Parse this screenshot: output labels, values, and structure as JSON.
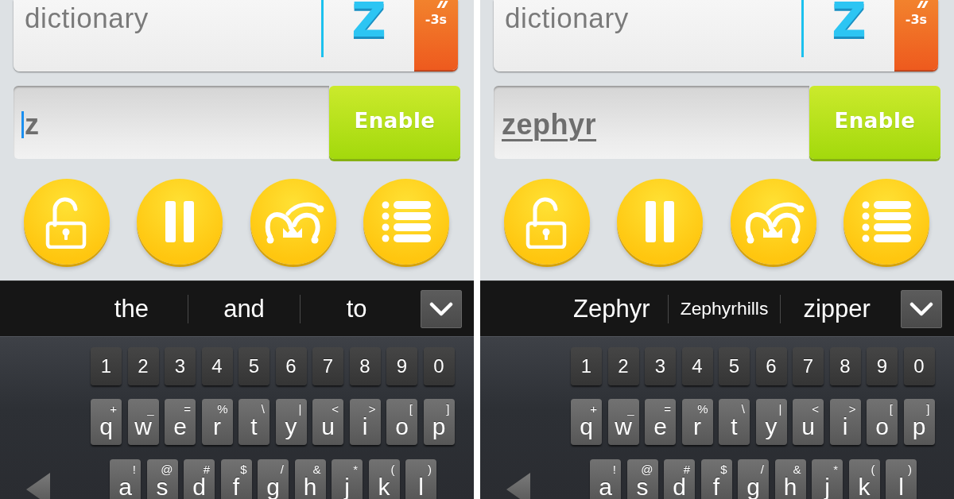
{
  "screens": [
    {
      "clue": {
        "text": "dictionary",
        "letter": "Z",
        "penalty": "-3s"
      },
      "answer_field": {
        "value": "z",
        "cursor": true,
        "underlined": false
      },
      "submit_button": {
        "label": "Enable"
      },
      "suggestions": [
        "the",
        "and",
        "to"
      ],
      "keyboard": {
        "number_row": [
          "1",
          "2",
          "3",
          "4",
          "5",
          "6",
          "7",
          "8",
          "9",
          "0"
        ],
        "letter_rows": [
          [
            {
              "key": "q",
              "alt": "+"
            },
            {
              "key": "w",
              "alt": "_"
            },
            {
              "key": "e",
              "alt": "="
            },
            {
              "key": "r",
              "alt": "%"
            },
            {
              "key": "t",
              "alt": "\\"
            },
            {
              "key": "y",
              "alt": "|"
            },
            {
              "key": "u",
              "alt": "<"
            },
            {
              "key": "i",
              "alt": ">"
            },
            {
              "key": "o",
              "alt": "["
            },
            {
              "key": "p",
              "alt": "]"
            }
          ],
          [
            {
              "key": "a",
              "alt": "!"
            },
            {
              "key": "s",
              "alt": "@"
            },
            {
              "key": "d",
              "alt": "#"
            },
            {
              "key": "f",
              "alt": "$"
            },
            {
              "key": "g",
              "alt": "/"
            },
            {
              "key": "h",
              "alt": "&"
            },
            {
              "key": "j",
              "alt": "*"
            },
            {
              "key": "k",
              "alt": "("
            },
            {
              "key": "l",
              "alt": ")"
            }
          ]
        ]
      }
    },
    {
      "clue": {
        "text": "dictionary",
        "letter": "Z",
        "penalty": "-3s"
      },
      "answer_field": {
        "value": "zephyr",
        "cursor": false,
        "underlined": true
      },
      "submit_button": {
        "label": "Enable"
      },
      "suggestions": [
        "Zephyr",
        "Zephyrhills",
        "zipper"
      ],
      "keyboard": {
        "number_row": [
          "1",
          "2",
          "3",
          "4",
          "5",
          "6",
          "7",
          "8",
          "9",
          "0"
        ],
        "letter_rows": [
          [
            {
              "key": "q",
              "alt": "+"
            },
            {
              "key": "w",
              "alt": "_"
            },
            {
              "key": "e",
              "alt": "="
            },
            {
              "key": "r",
              "alt": "%"
            },
            {
              "key": "t",
              "alt": "\\"
            },
            {
              "key": "y",
              "alt": "|"
            },
            {
              "key": "u",
              "alt": "<"
            },
            {
              "key": "i",
              "alt": ">"
            },
            {
              "key": "o",
              "alt": "["
            },
            {
              "key": "p",
              "alt": "]"
            }
          ],
          [
            {
              "key": "a",
              "alt": "!"
            },
            {
              "key": "s",
              "alt": "@"
            },
            {
              "key": "d",
              "alt": "#"
            },
            {
              "key": "f",
              "alt": "$"
            },
            {
              "key": "g",
              "alt": "/"
            },
            {
              "key": "h",
              "alt": "&"
            },
            {
              "key": "j",
              "alt": "*"
            },
            {
              "key": "k",
              "alt": "("
            },
            {
              "key": "l",
              "alt": ")"
            }
          ]
        ]
      }
    }
  ]
}
